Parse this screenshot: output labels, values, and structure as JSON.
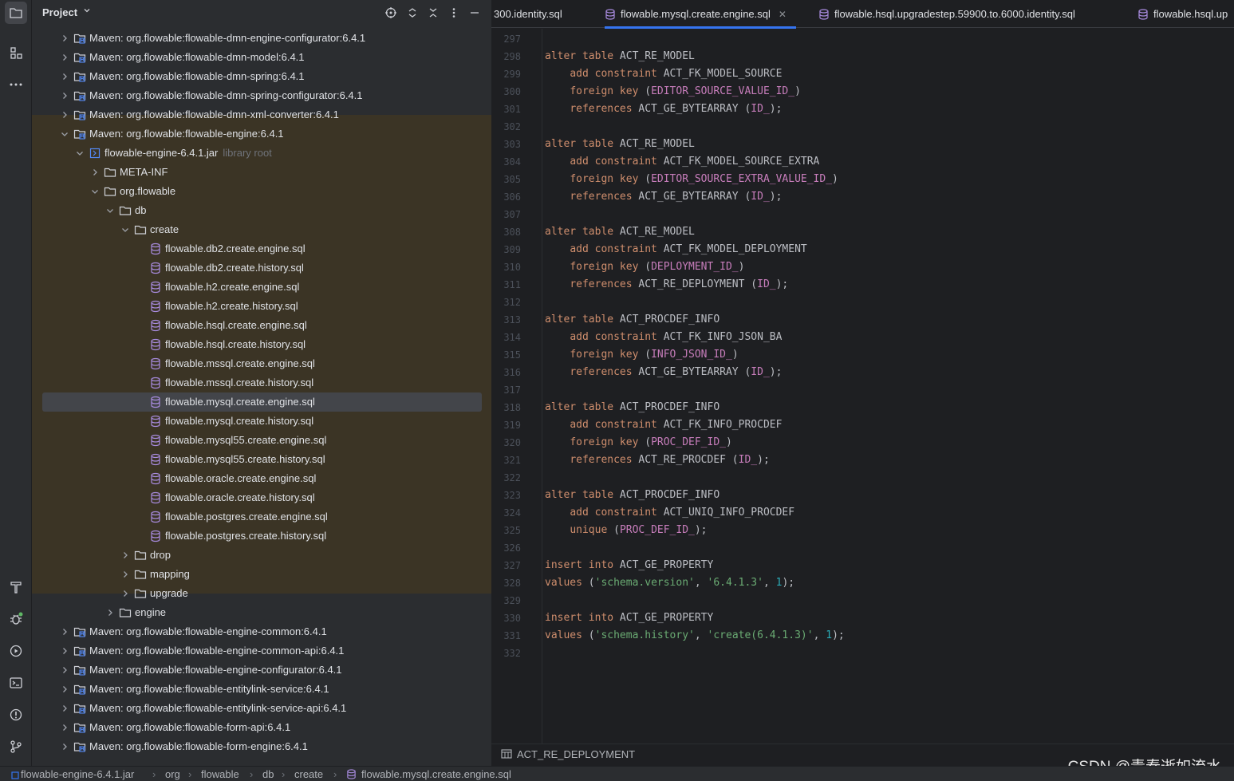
{
  "project_panel": {
    "title": "Project",
    "tree": [
      {
        "label": "Maven: org.flowable:flowable-dmn-engine-configurator:6.4.1",
        "kind": "maven",
        "depth": 0,
        "expanded": false
      },
      {
        "label": "Maven: org.flowable:flowable-dmn-model:6.4.1",
        "kind": "maven",
        "depth": 0,
        "expanded": false
      },
      {
        "label": "Maven: org.flowable:flowable-dmn-spring:6.4.1",
        "kind": "maven",
        "depth": 0,
        "expanded": false
      },
      {
        "label": "Maven: org.flowable:flowable-dmn-spring-configurator:6.4.1",
        "kind": "maven",
        "depth": 0,
        "expanded": false
      },
      {
        "label": "Maven: org.flowable:flowable-dmn-xml-converter:6.4.1",
        "kind": "maven",
        "depth": 0,
        "expanded": false
      },
      {
        "label": "Maven: org.flowable:flowable-engine:6.4.1",
        "kind": "maven",
        "depth": 0,
        "expanded": true
      },
      {
        "label": "flowable-engine-6.4.1.jar",
        "suffix": "library root",
        "kind": "jar",
        "depth": 1,
        "expanded": true
      },
      {
        "label": "META-INF",
        "kind": "folder",
        "depth": 2,
        "expanded": false
      },
      {
        "label": "org.flowable",
        "kind": "folder",
        "depth": 2,
        "expanded": true
      },
      {
        "label": "db",
        "kind": "folder",
        "depth": 3,
        "expanded": true
      },
      {
        "label": "create",
        "kind": "folder",
        "depth": 4,
        "expanded": true
      },
      {
        "label": "flowable.db2.create.engine.sql",
        "kind": "sql",
        "depth": 5
      },
      {
        "label": "flowable.db2.create.history.sql",
        "kind": "sql",
        "depth": 5
      },
      {
        "label": "flowable.h2.create.engine.sql",
        "kind": "sql",
        "depth": 5
      },
      {
        "label": "flowable.h2.create.history.sql",
        "kind": "sql",
        "depth": 5
      },
      {
        "label": "flowable.hsql.create.engine.sql",
        "kind": "sql",
        "depth": 5
      },
      {
        "label": "flowable.hsql.create.history.sql",
        "kind": "sql",
        "depth": 5
      },
      {
        "label": "flowable.mssql.create.engine.sql",
        "kind": "sql",
        "depth": 5
      },
      {
        "label": "flowable.mssql.create.history.sql",
        "kind": "sql",
        "depth": 5
      },
      {
        "label": "flowable.mysql.create.engine.sql",
        "kind": "sql",
        "depth": 5,
        "selected": true
      },
      {
        "label": "flowable.mysql.create.history.sql",
        "kind": "sql",
        "depth": 5
      },
      {
        "label": "flowable.mysql55.create.engine.sql",
        "kind": "sql",
        "depth": 5
      },
      {
        "label": "flowable.mysql55.create.history.sql",
        "kind": "sql",
        "depth": 5
      },
      {
        "label": "flowable.oracle.create.engine.sql",
        "kind": "sql",
        "depth": 5
      },
      {
        "label": "flowable.oracle.create.history.sql",
        "kind": "sql",
        "depth": 5
      },
      {
        "label": "flowable.postgres.create.engine.sql",
        "kind": "sql",
        "depth": 5
      },
      {
        "label": "flowable.postgres.create.history.sql",
        "kind": "sql",
        "depth": 5
      },
      {
        "label": "drop",
        "kind": "folder",
        "depth": 4,
        "expanded": false
      },
      {
        "label": "mapping",
        "kind": "folder",
        "depth": 4,
        "expanded": false
      },
      {
        "label": "upgrade",
        "kind": "folder",
        "depth": 4,
        "expanded": false
      },
      {
        "label": "engine",
        "kind": "folder",
        "depth": 3,
        "expanded": false
      },
      {
        "label": "Maven: org.flowable:flowable-engine-common:6.4.1",
        "kind": "maven",
        "depth": 0,
        "expanded": false
      },
      {
        "label": "Maven: org.flowable:flowable-engine-common-api:6.4.1",
        "kind": "maven",
        "depth": 0,
        "expanded": false
      },
      {
        "label": "Maven: org.flowable:flowable-engine-configurator:6.4.1",
        "kind": "maven",
        "depth": 0,
        "expanded": false
      },
      {
        "label": "Maven: org.flowable:flowable-entitylink-service:6.4.1",
        "kind": "maven",
        "depth": 0,
        "expanded": false
      },
      {
        "label": "Maven: org.flowable:flowable-entitylink-service-api:6.4.1",
        "kind": "maven",
        "depth": 0,
        "expanded": false
      },
      {
        "label": "Maven: org.flowable:flowable-form-api:6.4.1",
        "kind": "maven",
        "depth": 0,
        "expanded": false
      },
      {
        "label": "Maven: org.flowable:flowable-form-engine:6.4.1",
        "kind": "maven",
        "depth": 0,
        "expanded": false
      }
    ]
  },
  "tabs": [
    {
      "label": "300.identity.sql",
      "active": false,
      "icon": false
    },
    {
      "label": "flowable.mysql.create.engine.sql",
      "active": true,
      "icon": true,
      "closable": true
    },
    {
      "label": "flowable.hsql.upgradestep.59900.to.6000.identity.sql",
      "active": false,
      "icon": true
    },
    {
      "label": "flowable.hsql.up",
      "active": false,
      "icon": true
    }
  ],
  "code": {
    "first_line": 297,
    "lines": [
      [],
      [
        [
          "kw",
          "alter table "
        ],
        [
          "plain",
          "ACT_RE_MODEL"
        ]
      ],
      [
        [
          "plain",
          "    "
        ],
        [
          "kw",
          "add constraint "
        ],
        [
          "plain",
          "ACT_FK_MODEL_SOURCE"
        ]
      ],
      [
        [
          "plain",
          "    "
        ],
        [
          "kw",
          "foreign key "
        ],
        [
          "plain",
          "("
        ],
        [
          "fld",
          "EDITOR_SOURCE_VALUE_ID_"
        ],
        [
          "plain",
          ")"
        ]
      ],
      [
        [
          "plain",
          "    "
        ],
        [
          "kw",
          "references "
        ],
        [
          "plain",
          "ACT_GE_BYTEARRAY ("
        ],
        [
          "fld",
          "ID_"
        ],
        [
          "plain",
          ");"
        ]
      ],
      [],
      [
        [
          "kw",
          "alter table "
        ],
        [
          "plain",
          "ACT_RE_MODEL"
        ]
      ],
      [
        [
          "plain",
          "    "
        ],
        [
          "kw",
          "add constraint "
        ],
        [
          "plain",
          "ACT_FK_MODEL_SOURCE_EXTRA"
        ]
      ],
      [
        [
          "plain",
          "    "
        ],
        [
          "kw",
          "foreign key "
        ],
        [
          "plain",
          "("
        ],
        [
          "fld",
          "EDITOR_SOURCE_EXTRA_VALUE_ID_"
        ],
        [
          "plain",
          ")"
        ]
      ],
      [
        [
          "plain",
          "    "
        ],
        [
          "kw",
          "references "
        ],
        [
          "plain",
          "ACT_GE_BYTEARRAY ("
        ],
        [
          "fld",
          "ID_"
        ],
        [
          "plain",
          ");"
        ]
      ],
      [],
      [
        [
          "kw",
          "alter table "
        ],
        [
          "plain",
          "ACT_RE_MODEL"
        ]
      ],
      [
        [
          "plain",
          "    "
        ],
        [
          "kw",
          "add constraint "
        ],
        [
          "plain",
          "ACT_FK_MODEL_DEPLOYMENT"
        ]
      ],
      [
        [
          "plain",
          "    "
        ],
        [
          "kw",
          "foreign key "
        ],
        [
          "plain",
          "("
        ],
        [
          "fld",
          "DEPLOYMENT_ID_"
        ],
        [
          "plain",
          ")"
        ]
      ],
      [
        [
          "plain",
          "    "
        ],
        [
          "kw",
          "references "
        ],
        [
          "plain",
          "ACT_RE_DEPLOYMENT ("
        ],
        [
          "fld",
          "ID_"
        ],
        [
          "plain",
          ");"
        ]
      ],
      [],
      [
        [
          "kw",
          "alter table "
        ],
        [
          "plain",
          "ACT_PROCDEF_INFO"
        ]
      ],
      [
        [
          "plain",
          "    "
        ],
        [
          "kw",
          "add constraint "
        ],
        [
          "plain",
          "ACT_FK_INFO_JSON_BA"
        ]
      ],
      [
        [
          "plain",
          "    "
        ],
        [
          "kw",
          "foreign key "
        ],
        [
          "plain",
          "("
        ],
        [
          "fld",
          "INFO_JSON_ID_"
        ],
        [
          "plain",
          ")"
        ]
      ],
      [
        [
          "plain",
          "    "
        ],
        [
          "kw",
          "references "
        ],
        [
          "plain",
          "ACT_GE_BYTEARRAY ("
        ],
        [
          "fld",
          "ID_"
        ],
        [
          "plain",
          ");"
        ]
      ],
      [],
      [
        [
          "kw",
          "alter table "
        ],
        [
          "plain",
          "ACT_PROCDEF_INFO"
        ]
      ],
      [
        [
          "plain",
          "    "
        ],
        [
          "kw",
          "add constraint "
        ],
        [
          "plain",
          "ACT_FK_INFO_PROCDEF"
        ]
      ],
      [
        [
          "plain",
          "    "
        ],
        [
          "kw",
          "foreign key "
        ],
        [
          "plain",
          "("
        ],
        [
          "fld",
          "PROC_DEF_ID_"
        ],
        [
          "plain",
          ")"
        ]
      ],
      [
        [
          "plain",
          "    "
        ],
        [
          "kw",
          "references "
        ],
        [
          "plain",
          "ACT_RE_PROCDEF ("
        ],
        [
          "fld",
          "ID_"
        ],
        [
          "plain",
          ");"
        ]
      ],
      [],
      [
        [
          "kw",
          "alter table "
        ],
        [
          "plain",
          "ACT_PROCDEF_INFO"
        ]
      ],
      [
        [
          "plain",
          "    "
        ],
        [
          "kw",
          "add constraint "
        ],
        [
          "plain",
          "ACT_UNIQ_INFO_PROCDEF"
        ]
      ],
      [
        [
          "plain",
          "    "
        ],
        [
          "kw",
          "unique "
        ],
        [
          "plain",
          "("
        ],
        [
          "fld",
          "PROC_DEF_ID_"
        ],
        [
          "plain",
          ");"
        ]
      ],
      [],
      [
        [
          "kw",
          "insert into "
        ],
        [
          "plain",
          "ACT_GE_PROPERTY"
        ]
      ],
      [
        [
          "kw",
          "values "
        ],
        [
          "plain",
          "("
        ],
        [
          "str",
          "'schema.version'"
        ],
        [
          "plain",
          ", "
        ],
        [
          "str",
          "'6.4.1.3'"
        ],
        [
          "plain",
          ", "
        ],
        [
          "num",
          "1"
        ],
        [
          "plain",
          ");"
        ]
      ],
      [],
      [
        [
          "kw",
          "insert into "
        ],
        [
          "plain",
          "ACT_GE_PROPERTY"
        ]
      ],
      [
        [
          "kw",
          "values "
        ],
        [
          "plain",
          "("
        ],
        [
          "str",
          "'schema.history'"
        ],
        [
          "plain",
          ", "
        ],
        [
          "str",
          "'create(6.4.1.3)'"
        ],
        [
          "plain",
          ", "
        ],
        [
          "num",
          "1"
        ],
        [
          "plain",
          ");"
        ]
      ],
      []
    ]
  },
  "editor_breadcrumb": "ACT_RE_DEPLOYMENT",
  "status_path": [
    "flowable-engine-6.4.1.jar",
    "org",
    "flowable",
    "db",
    "create",
    "flowable.mysql.create.engine.sql"
  ],
  "watermark": "CSDN @青春逝如流水",
  "colors": {
    "keyword": "#cf8e6d",
    "field": "#c77dbb",
    "string": "#6aab73",
    "number": "#2aacb8",
    "accent": "#3574f0",
    "sql_icon": "#a98ce0",
    "highlight_band": "#3b3425"
  }
}
